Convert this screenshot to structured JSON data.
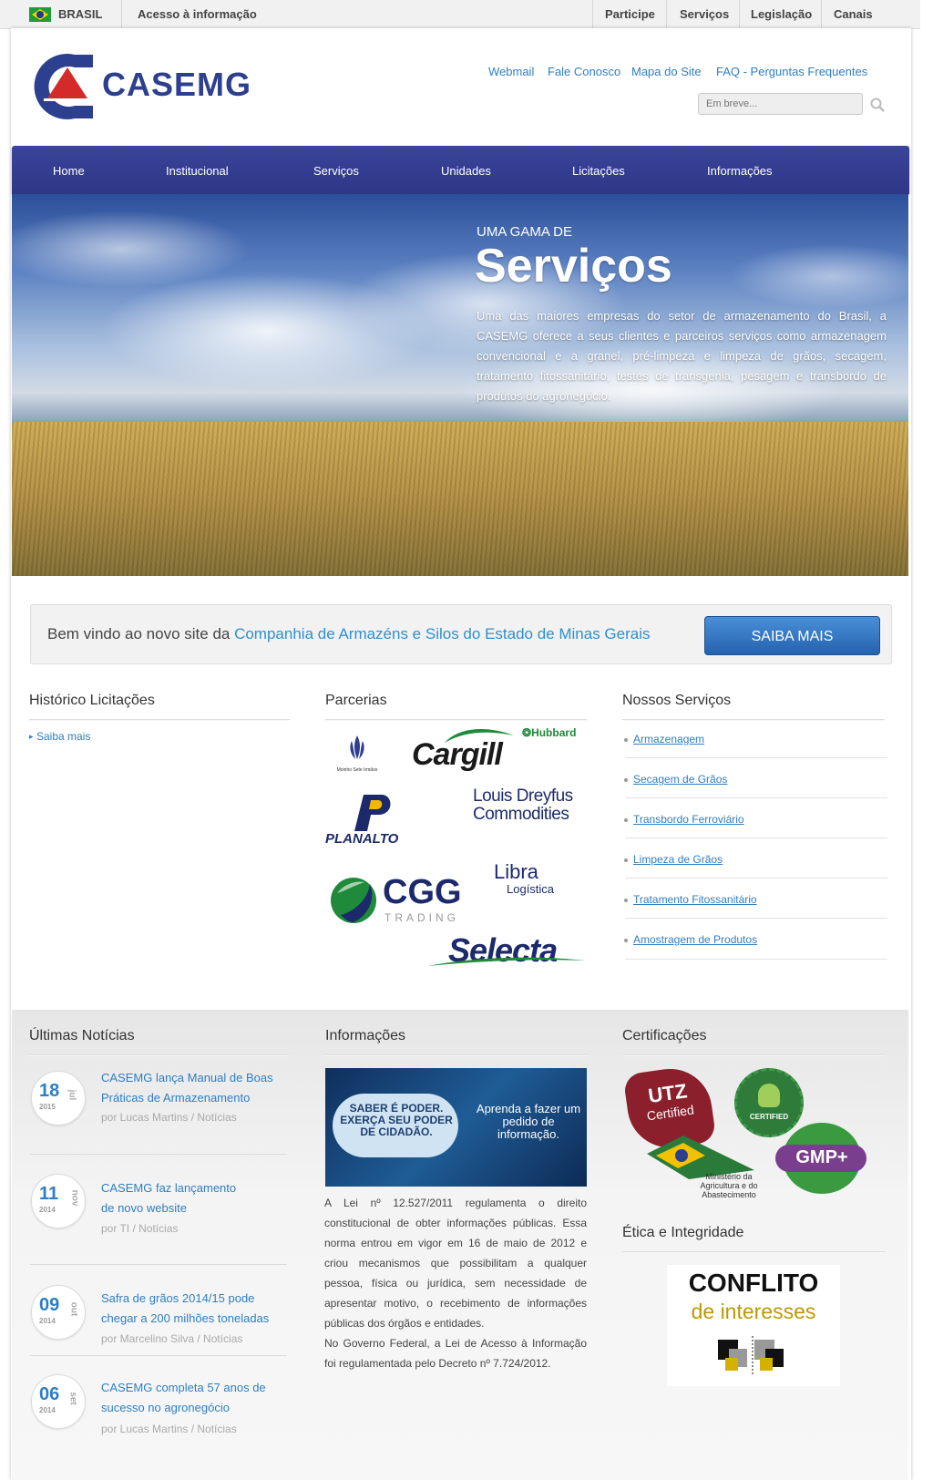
{
  "govbar": {
    "country": "BRASIL",
    "access": "Acesso à informação",
    "links": [
      "Participe",
      "Serviços",
      "Legislação",
      "Canais"
    ]
  },
  "header": {
    "logo_text": "CASEMG",
    "links": [
      "Webmail",
      "Fale Conosco",
      "Mapa do Site",
      "FAQ - Perguntas Frequentes"
    ],
    "search_placeholder": "Em breve..."
  },
  "nav": [
    "Home",
    "Institucional",
    "Serviços",
    "Unidades",
    "Licitações",
    "Informações"
  ],
  "hero": {
    "kicker": "UMA GAMA DE",
    "title": "Serviços",
    "description": "Uma das maiores empresas do setor de armazenamento do Brasil, a CASEMG oferece a seus clientes e parceiros serviços como armazenagem convencional e a granel, pré-limpeza e limpeza de grãos, secagem, tratamento fitossanitário, testes de transgenia, pesagem e transbordo de produtos do agronegócio."
  },
  "welcome": {
    "text": "Bem vindo ao novo site da ",
    "link": "Companhia de Armazéns e Silos do Estado de Minas Gerais",
    "button": "SAIBA MAIS"
  },
  "historico": {
    "title": "Histórico Licitações",
    "link": "Saiba mais"
  },
  "parcerias": {
    "title": "Parcerias",
    "logos": {
      "moinho": "Moinho Sete Irmãos",
      "cargill": "Cargill",
      "hubbard": "Hubbard",
      "louis1": "Louis Dreyfus",
      "louis2": "Commodities",
      "planalto": "PLANALTO",
      "cgg": "CGG",
      "cgg_sub": "TRADING",
      "libra": "Libra",
      "libra_sub": "Logística",
      "selecta": "Selecta"
    }
  },
  "servicos": {
    "title": "Nossos Serviços",
    "items": [
      "Armazenagem",
      "Secagem de Grãos",
      "Transbordo Ferroviário",
      "Limpeza de Grãos",
      "Tratamento Fitossanitário",
      "Amostragem de Produtos"
    ]
  },
  "noticias": {
    "title": "Últimas Notícias",
    "items": [
      {
        "day": "18",
        "month": "jul",
        "year": "2015",
        "title": "CASEMG lança Manual de Boas Práticas de Armazenamento",
        "meta": "por Lucas Martins / Notícias"
      },
      {
        "day": "11",
        "month": "nov",
        "year": "2014",
        "title": "CASEMG faz lançamento de novo website",
        "meta": "por TI / Notícias"
      },
      {
        "day": "09",
        "month": "out",
        "year": "2014",
        "title": "Safra de grãos 2014/15 pode chegar a 200 milhões toneladas",
        "meta": "por Marcelino Silva / Notícias"
      },
      {
        "day": "06",
        "month": "set",
        "year": "2014",
        "title": "CASEMG completa 57 anos de sucesso no agronegócio",
        "meta": "por Lucas Martins / Notícias"
      }
    ]
  },
  "informacoes": {
    "title": "Informações",
    "banner_left": "SABER É PODER. EXERÇA SEU PODER DE CIDADÃO.",
    "banner_right": "Aprenda a fazer um pedido de informação.",
    "text": "A Lei nº 12.527/2011 regulamenta o direito constitucional de obter informações públicas. Essa norma entrou em vigor em 16 de maio de 2012 e criou mecanismos que possibilitam a qualquer pessoa, física ou jurídica, sem necessidade de apresentar motivo, o recebimento de informações públicas dos órgãos e entidades.",
    "text2": "No Governo Federal, a Lei de Acesso à Informação foi regulamentada pelo Decreto nº 7.724/2012."
  },
  "certificacoes": {
    "title": "Certificações",
    "utz1": "UTZ",
    "utz2": "Certified",
    "rainforest": "CERTIFIED",
    "gmp": "GMP+",
    "ministerio": "Ministério da Agricultura e do Abastecimento"
  },
  "etica": {
    "title": "Ética e Integridade",
    "conflito1": "CONFLITO",
    "conflito2": "de interesses"
  },
  "colors": {
    "brand": "#2d3f8f",
    "nav": "#333d90",
    "link": "#2f7ec2",
    "logo_red": "#d42a2a"
  }
}
